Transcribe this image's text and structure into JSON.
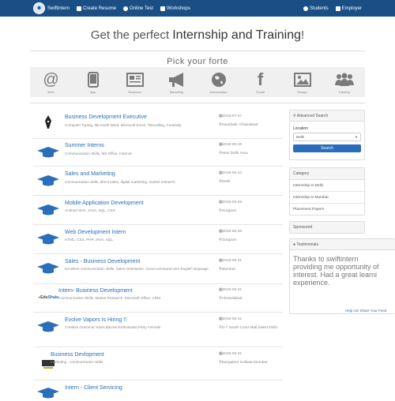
{
  "navbar": {
    "brand": "Swiftintern",
    "items": [
      "Create Resume",
      "Online Test",
      "Workshops"
    ],
    "right_items": [
      "Students",
      "Employer"
    ],
    "color": "#1a4f86"
  },
  "hero": {
    "prefix": "Get the perfect ",
    "emphasis": "Internship and Training",
    "suffix": "!"
  },
  "forte": {
    "title": "Pick your forte",
    "categories": [
      {
        "label": "Web",
        "icon": "at-icon"
      },
      {
        "label": "App",
        "icon": "tablet-icon"
      },
      {
        "label": "Business",
        "icon": "newspaper-icon"
      },
      {
        "label": "Marketing",
        "icon": "bullhorn-icon"
      },
      {
        "label": "Ambassador",
        "icon": "globe-icon"
      },
      {
        "label": "Social",
        "icon": "facebook-icon"
      },
      {
        "label": "Design",
        "icon": "picture-icon"
      },
      {
        "label": "Training",
        "icon": "group-icon"
      }
    ]
  },
  "jobs": [
    {
      "title": "Business Development Executive",
      "skills": "Computer Typing, Microsoft Word, Microsoft Excel, Telecalling, Creativity",
      "date": "2016-07-27",
      "location": "Kaushabi, Ghaziabad",
      "logo": "pen-logo"
    },
    {
      "title": "Summer Interns",
      "skills": "Communication Skills, MS Office, Internet",
      "date": "2016-06-19",
      "location": "New Delhi Area",
      "logo": "graduation-cap-icon"
    },
    {
      "title": "Sales and Marketing",
      "skills": "communication skills, direct sales, digital marketing, market research",
      "date": "2016-06-13",
      "location": "Delhi",
      "logo": "graduation-cap-icon"
    },
    {
      "title": "Mobile Application Development",
      "skills": "Android SDK, JAVA, SQL, CSS",
      "date": "2016-05-28",
      "location": "Gurgaon",
      "logo": "graduation-cap-icon"
    },
    {
      "title": "Web Development Intern",
      "skills": "HTML, CSS, PHP, JAVA, SQL",
      "date": "2016-05-28",
      "location": "Gurgaon",
      "logo": "graduation-cap-icon"
    },
    {
      "title": "Sales - Business Development",
      "skills": "Excellent communication skills, Sales Orientation, Good command over English language",
      "date": "2016-05-31",
      "location": "Mumbai",
      "logo": "graduation-cap-icon"
    },
    {
      "title": "Intern- Business Development",
      "skills": "Communication Skills, Market Research, Microsoft Office, CRM",
      "date": "2016-05-31",
      "location": "Ahmedabad",
      "logo": "company-logo"
    },
    {
      "title": "Evolve Vapors Is Hiring !!",
      "skills": "Creative,Grammar Nazis,Barone Enthusiasts,Party Animals",
      "date": "2016-05-31",
      "location": "D-7 South Court Mall,Saket Delhi",
      "logo": "graduation-cap-icon"
    },
    {
      "title": "Business Devlopment",
      "skills": "marketing , communication skills",
      "date": "2016-05-31",
      "location": "Bangalore Kolkata Mumbai",
      "logo": "company-logo-dark"
    },
    {
      "title": "Intern - Client Servicing",
      "skills": "",
      "date": "",
      "location": "",
      "logo": "graduation-cap-icon"
    }
  ],
  "sidebar": {
    "advanced_search": {
      "heading": "Advanced Search",
      "location_label": "Location",
      "location_value": "Delhi",
      "button": "Search"
    },
    "category": {
      "heading": "Category",
      "links": [
        "Internship in Delhi",
        "Internship in Mumbai",
        "Placement Papers"
      ]
    },
    "sponsored": "Sponsored",
    "testimonials": {
      "heading": "Testimonials",
      "lines": [
        "Thanks to swiftintern",
        "providing me opportunity of",
        "interest. Had a great learni",
        "experience."
      ],
      "share_link": "Help Us! Share Your Feed"
    }
  },
  "colors": {
    "accent": "#2a6ebb",
    "nav": "#1a4f86",
    "panel_bg": "#f5f5f5"
  }
}
